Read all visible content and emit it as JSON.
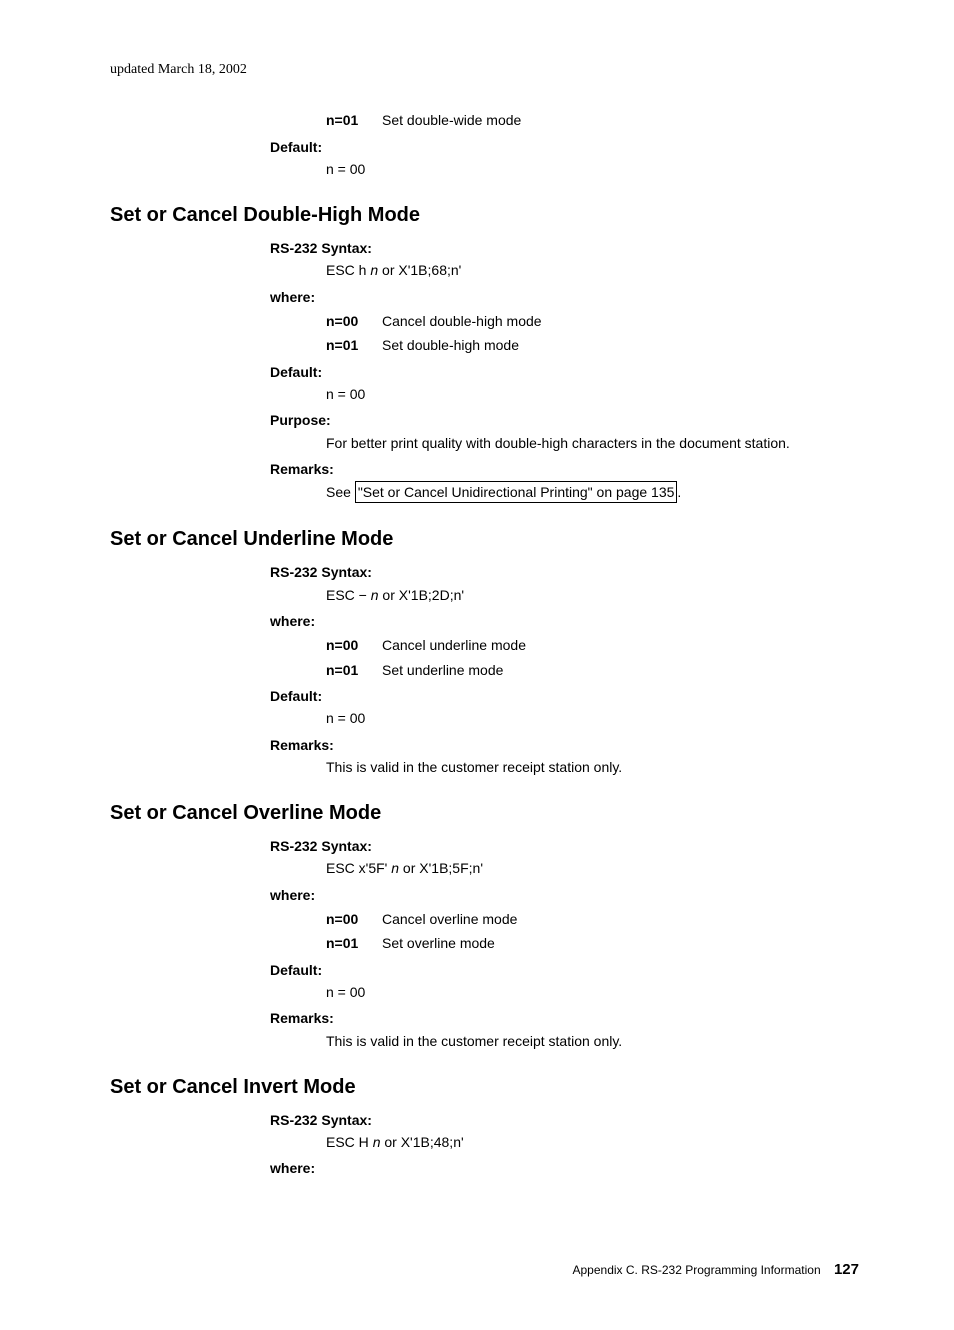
{
  "updated": "updated March 18, 2002",
  "top": {
    "n01_term": "n=01",
    "n01_desc": "Set double-wide mode",
    "default_label": "Default:",
    "default_val": "n = 00"
  },
  "sec_dh": {
    "heading": "Set or Cancel Double-High Mode",
    "syntax_label": "RS-232 Syntax:",
    "syntax_pre": "ESC h ",
    "syntax_ital": "n",
    "syntax_post": " or X'1B;68;n'",
    "where_label": "where:",
    "n00_term": "n=00",
    "n00_desc": "Cancel double-high mode",
    "n01_term": "n=01",
    "n01_desc": "Set double-high mode",
    "default_label": "Default:",
    "default_val": "n = 00",
    "purpose_label": "Purpose:",
    "purpose_text": "For better print quality with double-high characters in the document station.",
    "remarks_label": "Remarks:",
    "remarks_pre": "See ",
    "remarks_link": "\"Set or Cancel Unidirectional Printing\" on page 135",
    "remarks_post": "."
  },
  "sec_ul": {
    "heading": "Set or Cancel Underline Mode",
    "syntax_label": "RS-232 Syntax:",
    "syntax_pre": "ESC − ",
    "syntax_ital": "n",
    "syntax_post": " or X'1B;2D;n'",
    "where_label": "where:",
    "n00_term": "n=00",
    "n00_desc": "Cancel underline mode",
    "n01_term": "n=01",
    "n01_desc": "Set underline mode",
    "default_label": "Default:",
    "default_val": "n = 00",
    "remarks_label": "Remarks:",
    "remarks_text": "This is valid in the customer receipt station only."
  },
  "sec_ol": {
    "heading": "Set or Cancel Overline Mode",
    "syntax_label": "RS-232 Syntax:",
    "syntax_pre": "ESC x'5F' ",
    "syntax_ital": "n",
    "syntax_post": " or X'1B;5F;n'",
    "where_label": "where:",
    "n00_term": "n=00",
    "n00_desc": "Cancel overline mode",
    "n01_term": "n=01",
    "n01_desc": "Set overline mode",
    "default_label": "Default:",
    "default_val": "n = 00",
    "remarks_label": "Remarks:",
    "remarks_text": "This is valid in the customer receipt station only."
  },
  "sec_inv": {
    "heading": "Set or Cancel Invert Mode",
    "syntax_label": "RS-232 Syntax:",
    "syntax_pre": "ESC H ",
    "syntax_ital": "n",
    "syntax_post": " or X'1B;48;n'",
    "where_label": "where:"
  },
  "footer": {
    "text": "Appendix C. RS-232 Programming Information",
    "page": "127"
  }
}
